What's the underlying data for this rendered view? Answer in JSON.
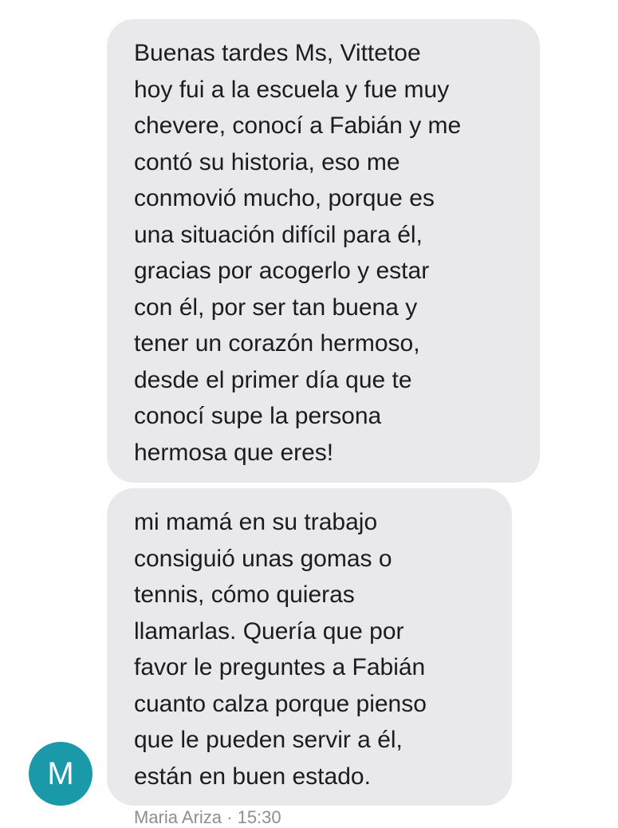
{
  "messages": [
    {
      "lines": [
        "Buenas tardes Ms, Vittetoe",
        "hoy fui a la escuela y fue muy",
        "chevere, conocí a Fabián y me",
        "contó su historia, eso me",
        "conmovió mucho, porque es",
        "una situación difícil para él,",
        "gracias por acogerlo y estar",
        "con él, por ser tan buena y",
        "tener un corazón hermoso,",
        "desde el primer día que te",
        "conocí supe la persona",
        "hermosa que eres!"
      ]
    },
    {
      "lines": [
        "mi mamá en su trabajo",
        "consiguió unas gomas o",
        "tennis, cómo quieras",
        "llamarlas. Quería que por",
        "favor le preguntes a Fabián",
        "cuanto calza porque pienso",
        "que le pueden servir a él,",
        "están en buen estado."
      ]
    }
  ],
  "sender": {
    "avatar_initial": "M",
    "meta_partial": "Maria Ariza · 15:30"
  },
  "colors": {
    "bubble": "#e9e9eb",
    "text": "#1c1c1e",
    "avatar": "#1a9aa8",
    "meta": "#8e8e93"
  }
}
